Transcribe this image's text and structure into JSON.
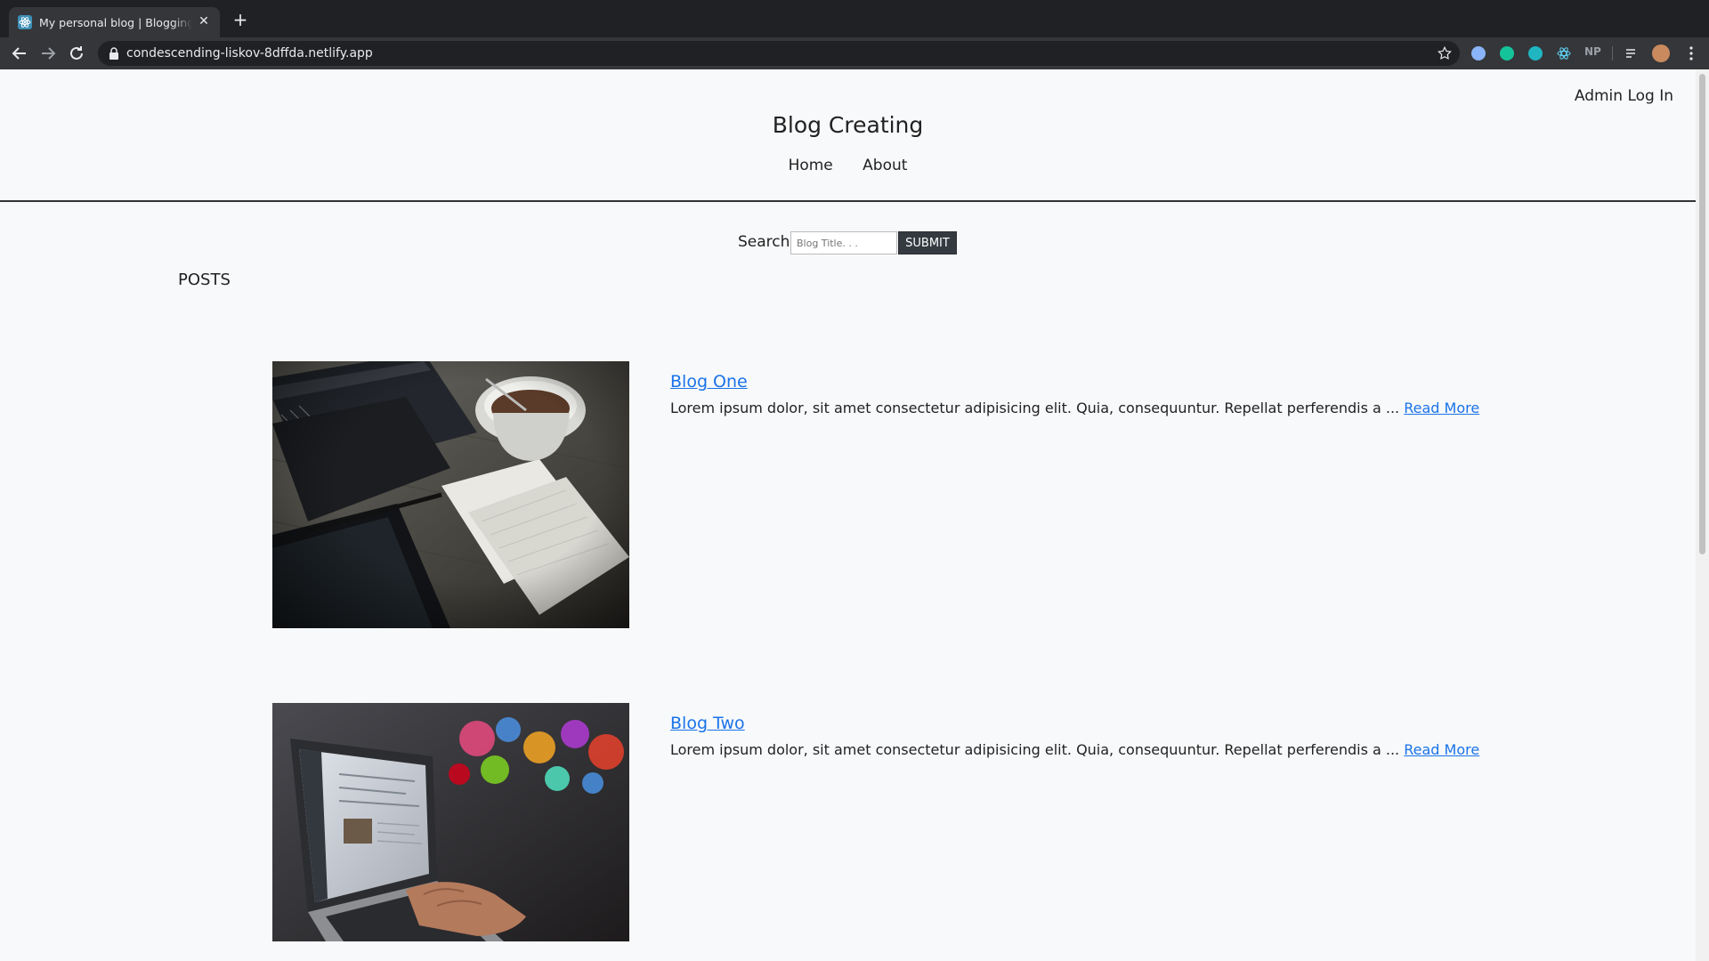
{
  "browser": {
    "tab_title": "My personal blog | Blogging simply",
    "url": "condescending-liskov-8dffda.netlify.app",
    "extension_np_label": "NP"
  },
  "header": {
    "admin_link": "Admin Log In",
    "site_title": "Blog Creating",
    "nav": [
      "Home",
      "About"
    ]
  },
  "search": {
    "label": "Search:",
    "placeholder": "Blog Title. . .",
    "submit_label": "SUBMIT"
  },
  "posts_heading": "POSTS",
  "posts": [
    {
      "title": "Blog One",
      "excerpt": "Lorem ipsum dolor, sit amet consectetur adipisicing elit. Quia, consequuntur. Repellat perferendis a ...",
      "read_more": "Read More",
      "image": "notebook-coffee-photo"
    },
    {
      "title": "Blog Two",
      "excerpt": "Lorem ipsum dolor, sit amet consectetur adipisicing elit. Quia, consequuntur. Repellat perferendis a ...",
      "read_more": "Read More",
      "image": "laptop-typing-photo"
    }
  ],
  "colors": {
    "link": "#1a73e8",
    "submit_bg": "#343a40",
    "page_bg": "#f8f9fb"
  }
}
